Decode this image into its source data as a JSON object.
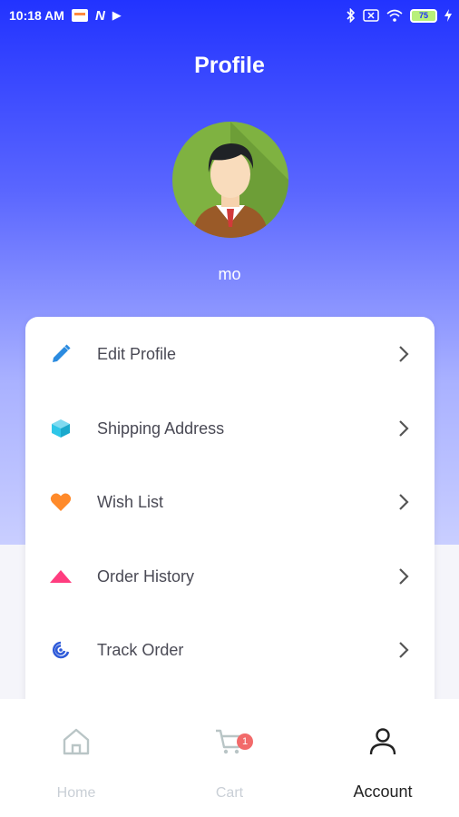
{
  "status_bar": {
    "time": "10:18 AM",
    "battery": "75"
  },
  "header": {
    "title": "Profile"
  },
  "profile": {
    "username": "mo"
  },
  "menu": {
    "items": [
      {
        "label": "Edit Profile",
        "icon": "pencil-icon",
        "color": "#2b8be0"
      },
      {
        "label": "Shipping Address",
        "icon": "package-box-icon",
        "color": "#2ec6e8"
      },
      {
        "label": "Wish List",
        "icon": "heart-icon",
        "color": "#ff8a2a"
      },
      {
        "label": "Order History",
        "icon": "triangle-icon",
        "color": "#ff3d7f"
      },
      {
        "label": "Track Order",
        "icon": "radar-icon",
        "color": "#2f5bd9"
      }
    ]
  },
  "bottom_nav": {
    "items": [
      {
        "label": "Home",
        "icon": "home-icon"
      },
      {
        "label": "Cart",
        "icon": "cart-icon",
        "badge": "1"
      },
      {
        "label": "Account",
        "icon": "user-icon",
        "active": true
      }
    ]
  },
  "colors": {
    "primary": "#2233ff",
    "badge": "#f26a6a",
    "inactive_nav": "#c9cfd6"
  }
}
